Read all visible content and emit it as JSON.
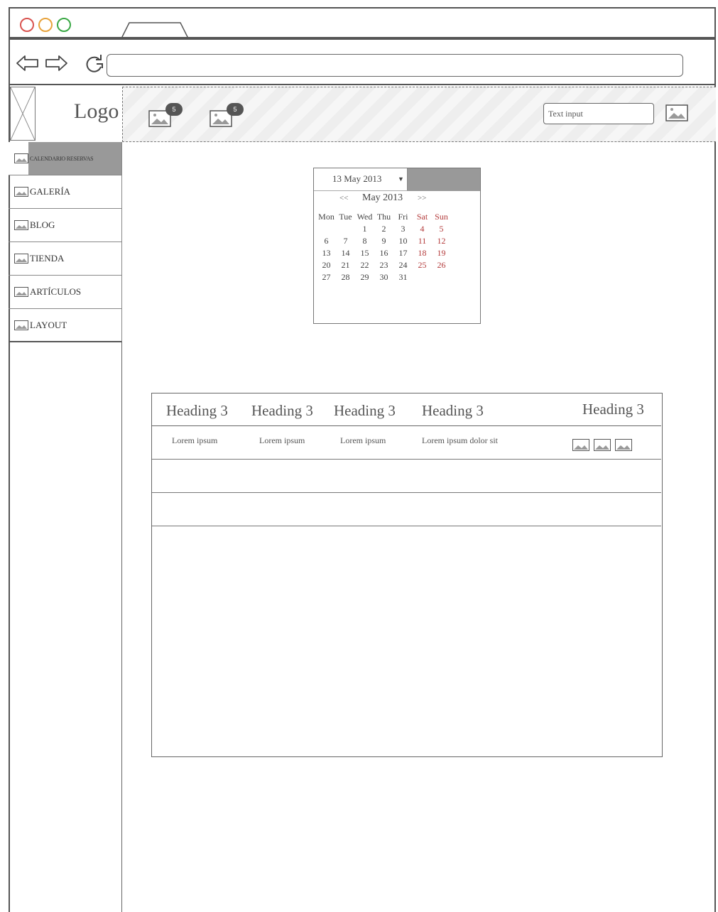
{
  "browser": {
    "url": ""
  },
  "header": {
    "logo": "Logo",
    "notifications": [
      {
        "count": "5",
        "icon": "image-icon"
      },
      {
        "count": "5",
        "icon": "image-icon"
      }
    ],
    "search_placeholder": "Text input"
  },
  "sidebar": {
    "items": [
      {
        "label": "CALENDARIO RESERVAS",
        "icon": "image-icon",
        "active": true
      },
      {
        "label": "GALERÍA",
        "icon": "image-icon"
      },
      {
        "label": "BLOG",
        "icon": "image-icon"
      },
      {
        "label": "TIENDA",
        "icon": "image-icon"
      },
      {
        "label": "ARTÍCULOS",
        "icon": "image-icon"
      },
      {
        "label": "LAYOUT",
        "icon": "image-icon"
      }
    ]
  },
  "calendar": {
    "selected_date": "13 May 2013",
    "month_label": "May 2013",
    "prev": "<<",
    "next": ">>",
    "weekdays": [
      "Mon",
      "Tue",
      "Wed",
      "Thu",
      "Fri",
      "Sat",
      "Sun"
    ],
    "weeks": [
      [
        "",
        "",
        "1",
        "2",
        "3",
        "4",
        "5"
      ],
      [
        "6",
        "7",
        "8",
        "9",
        "10",
        "11",
        "12"
      ],
      [
        "13",
        "14",
        "15",
        "16",
        "17",
        "18",
        "19"
      ],
      [
        "20",
        "21",
        "22",
        "23",
        "24",
        "25",
        "26"
      ],
      [
        "27",
        "28",
        "29",
        "30",
        "31",
        "",
        ""
      ]
    ],
    "weekend_color": "#b33a3a"
  },
  "table": {
    "headers": [
      "Heading 3",
      "Heading 3",
      "Heading 3",
      "Heading 3",
      "Heading 3"
    ],
    "rows": [
      [
        "Lorem ipsum",
        "Lorem ipsum",
        "Lorem ipsum",
        "Lorem ipsum dolor sit"
      ]
    ],
    "row_actions": [
      "image-icon",
      "image-icon",
      "image-icon"
    ]
  },
  "colors": {
    "red_dot": "#d9534f",
    "yellow_dot": "#e8a33c",
    "green_dot": "#3aa845"
  }
}
